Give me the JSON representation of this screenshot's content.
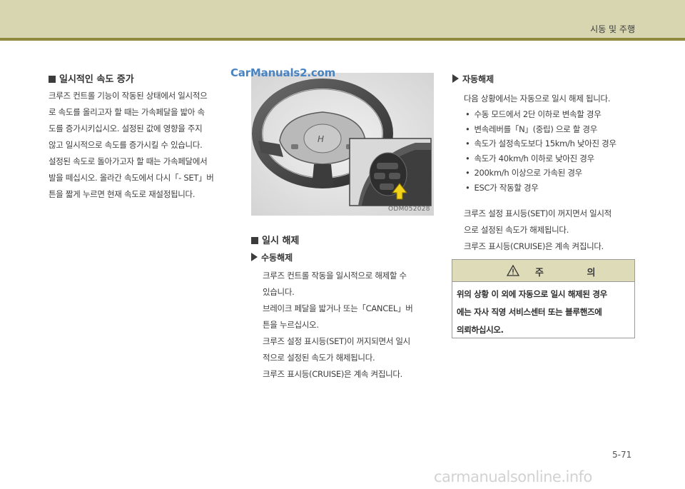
{
  "header": {
    "section_title": "시동 및 주행"
  },
  "watermark_top": "CarManuals2.com",
  "left_section": {
    "title": "일시적인 속도 증가",
    "lines": [
      "크루즈 컨트롤 기능이 작동된 상태에서 일시적으",
      "로 속도를 올리고자 할 때는 가속페달을 밟아 속",
      "도를 증가시키십시오. 설정된 값에 영향을 주지",
      "않고 일시적으로 속도를 증가시킬 수 있습니다.",
      "설정된 속도로 돌아가고자 할 때는 가속페달에서",
      "발을 떼십시오. 올라간 속도에서 다시「- SET」버",
      "튼을 짧게 누르면 현재 속도로 재설정됩니다."
    ]
  },
  "figure": {
    "code": "ODM052028"
  },
  "middle_section": {
    "title": "일시 해제",
    "subtitle": "수동해제",
    "lines": [
      "크루즈 컨트롤 작동을 일시적으로 해제할 수",
      "있습니다.",
      "브레이크 페달을 밟거나 또는「CANCEL」버",
      "튼을 누르십시오.",
      "크루즈 설정 표시등(SET)이 꺼지되면서 일시",
      "적으로 설정된 속도가 해제됩니다.",
      "크루즈 표시등(CRUISE)은 계속 켜집니다."
    ]
  },
  "right_section": {
    "subtitle": "자동해제",
    "intro": "다음 상황에서는 자동으로 일시 해제 됩니다.",
    "bullets": [
      "수동 모드에서 2단 이하로 변속할 경우",
      "변속레버를「N」(중립) 으로 할 경우",
      "속도가 설정속도보다 15km/h 낮아진 경우",
      "속도가 40km/h 이하로 낮아진 경우",
      "200km/h 이상으로 가속된 경우",
      "ESC가 작동할 경우"
    ],
    "after_lines": [
      "크루즈 설정 표시등(SET)이 꺼지면서 일시적",
      "으로 설정된 속도가 해제됩니다.",
      "크루즈 표시등(CRUISE)은 계속 켜집니다."
    ]
  },
  "caution": {
    "title": "주 의",
    "lines": [
      "위의 상황 이 외에 자동으로 일시 해제된 경우",
      "에는 자사 직영 서비스센터 또는 블루핸즈에",
      "의뢰하십시오."
    ]
  },
  "page_number": "5-71",
  "footer_watermark": "carmanualsonline.info",
  "colors": {
    "header_band": "#d7d6b1",
    "header_line": "#8f8a3e",
    "caution_band": "#dedcb8",
    "watermark_blue": "#4a83c2"
  }
}
